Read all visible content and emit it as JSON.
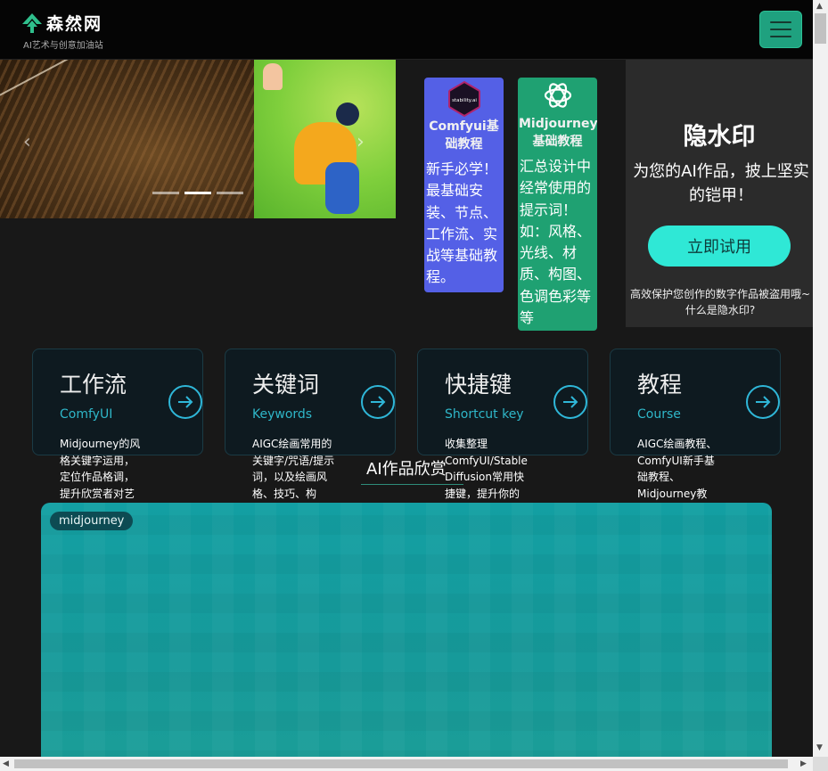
{
  "header": {
    "logo_name": "森然网",
    "logo_subtitle": "AI艺术与创意加油站",
    "menu_icon": "hamburger-icon",
    "accent": "#1fa17f"
  },
  "carousel": {
    "slide_count": 3,
    "active_index": 1
  },
  "promo": {
    "comfy": {
      "title": "Comfyui基础教程",
      "icon_label": "stability.ai",
      "body": "新手必学！最基础安装、节点、工作流、实战等基础教程。",
      "color": "#5460e6"
    },
    "midjourney": {
      "title": "Midjourney基础教程",
      "body": "汇总设计中经常使用的提示词！如：风格、光线、材质、构图、色调色彩等等",
      "color": "#1fa172"
    }
  },
  "watermark": {
    "title": "隐水印",
    "description": "为您的AI作品，披上坚实的铠甲！",
    "button": "立即试用",
    "note": "高效保护您创作的数字作品被盗用哦~什么是隐水印?",
    "button_color": "#2fe8d6"
  },
  "categories": [
    {
      "title": "工作流",
      "subtitle": "ComfyUI",
      "description": "Midjourney的风格关键字运用，定位作品格调，提升欣赏者对艺"
    },
    {
      "title": "关键词",
      "subtitle": "Keywords",
      "description": "AIGC绘画常用的关键字/咒语/提示词，以及绘画风格、技巧、构"
    },
    {
      "title": "快捷键",
      "subtitle": "Shortcut key",
      "description": "收集整理ComfyUI/Stable Diffusion常用快捷键，提升你的"
    },
    {
      "title": "教程",
      "subtitle": "Course",
      "description": "AIGC绘画教程、ComfyUI新手基础教程、Midjourney教"
    }
  ],
  "gallery": {
    "title": "AI作品欣赏",
    "tag": "midjourney"
  }
}
